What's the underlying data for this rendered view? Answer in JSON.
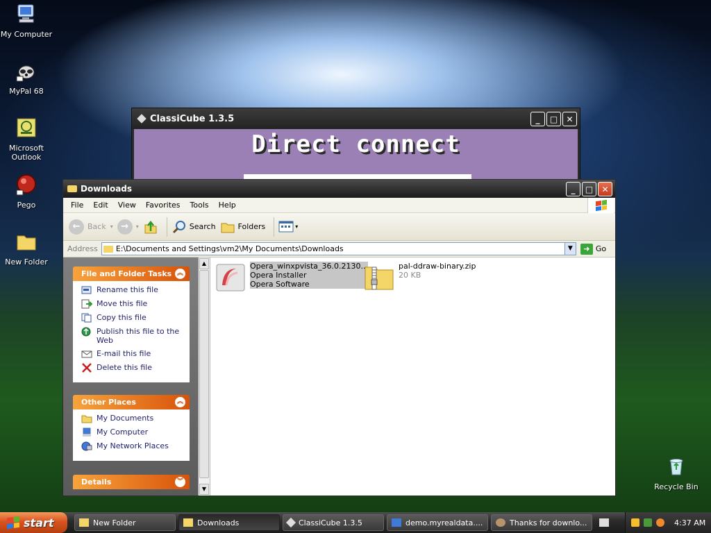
{
  "desktop": {
    "icons": [
      {
        "label": "My Computer"
      },
      {
        "label": "MyPal 68"
      },
      {
        "label": "Microsoft Outlook"
      },
      {
        "label": "Pego"
      },
      {
        "label": "New Folder"
      },
      {
        "label": "Recycle Bin"
      }
    ]
  },
  "classicube": {
    "title": "ClassiCube 1.3.5",
    "heading": "Direct connect"
  },
  "explorer": {
    "title": "Downloads",
    "menu": [
      "File",
      "Edit",
      "View",
      "Favorites",
      "Tools",
      "Help"
    ],
    "toolbar": {
      "back": "Back",
      "search": "Search",
      "folders": "Folders"
    },
    "address": {
      "label": "Address",
      "path": "E:\\Documents and Settings\\vm2\\My Documents\\Downloads",
      "go": "Go"
    },
    "tasks": {
      "header": "File and Folder Tasks",
      "items": [
        "Rename this file",
        "Move this file",
        "Copy this file",
        "Publish this file to the Web",
        "E-mail this file",
        "Delete this file"
      ]
    },
    "other_places": {
      "header": "Other Places",
      "items": [
        "My Documents",
        "My Computer",
        "My Network Places"
      ]
    },
    "details": {
      "header": "Details"
    },
    "files": [
      {
        "name": "Opera_winxpvista_36.0.2130...",
        "line2": "Opera Installer",
        "line3": "Opera Software",
        "selected": true
      },
      {
        "name": "pal-ddraw-binary.zip",
        "line2": "20 KB",
        "selected": false
      }
    ]
  },
  "taskbar": {
    "start": "start",
    "buttons": [
      {
        "label": "New Folder",
        "active": false
      },
      {
        "label": "Downloads",
        "active": true
      },
      {
        "label": "ClassiCube 1.3.5",
        "active": false
      },
      {
        "label": "demo.myrealdata....",
        "active": false
      },
      {
        "label": "Thanks for downlo...",
        "active": false
      }
    ],
    "clock": "4:37 AM"
  },
  "colors": {
    "task_orange": "#e0650f",
    "link_blue": "#1e1e6a",
    "cc_purple": "#9b80b5"
  }
}
